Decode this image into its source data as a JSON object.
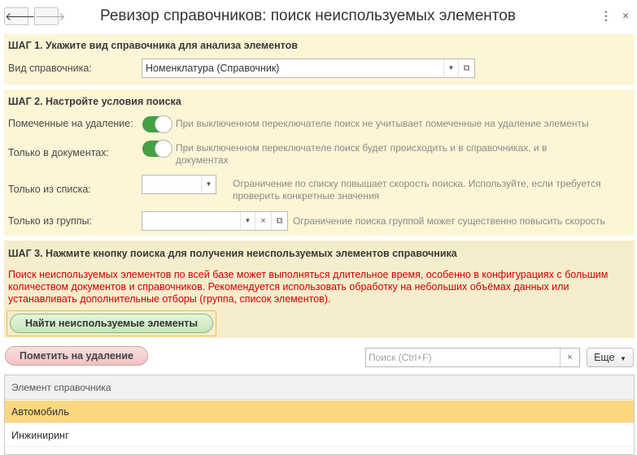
{
  "header": {
    "title": "Ревизор справочников: поиск неиспользуемых элементов",
    "back_icon": "🡐",
    "forward_icon": "🡒",
    "more_icon": "⋮",
    "close_icon": "×"
  },
  "step1": {
    "title": "ШАГ 1. Укажите вид справочника для анализа элементов",
    "label": "Вид справочника:",
    "value": "Номенклатура (Справочник)"
  },
  "step2": {
    "title": "ШАГ 2. Настройте условия поиска",
    "marked": {
      "label": "Помеченные на удаление:",
      "hint": "При выключенном переключателе поиск не учитывает помеченные на удаление элементы",
      "on": true
    },
    "docs_only": {
      "label": "Только в документах:",
      "hint": "При выключенном переключателе поиск будет происходить и в справочниках, и в документах",
      "on": true
    },
    "from_list": {
      "label": "Только из списка:",
      "value": "",
      "hint": "Ограничение по списку повышает скорость поиска. Используйте, если требуется проверить конкретные значения"
    },
    "from_group": {
      "label": "Только из группы:",
      "value": "",
      "hint": "Ограничение поиска группой может существенно повысить скорость"
    }
  },
  "step3": {
    "title": "ШАГ 3. Нажмите кнопку поиска для получения неиспользуемых элементов справочника",
    "warning": "Поиск неиспользуемых элементов по всей базе может выполняться длительное время, особенно в конфигурациях с большим количеством документов и справочников. Рекомендуется использовать обработку на небольших объёмах данных или устанавливать дополнительные отборы (группа, список элементов).",
    "find_button": "Найти неиспользуемые элементы"
  },
  "toolbar": {
    "mark_button": "Пометить на удаление",
    "search_placeholder": "Поиск (Ctrl+F)",
    "more_button": "Еще"
  },
  "table": {
    "column": "Элемент справочника",
    "rows": [
      "Автомобиль",
      "Инжиниринг"
    ]
  },
  "colors": {
    "step_bg": "#fcf5d6",
    "toggle_on": "#43a047",
    "warning_text": "#d10000",
    "selected_row": "#fcd77f"
  }
}
